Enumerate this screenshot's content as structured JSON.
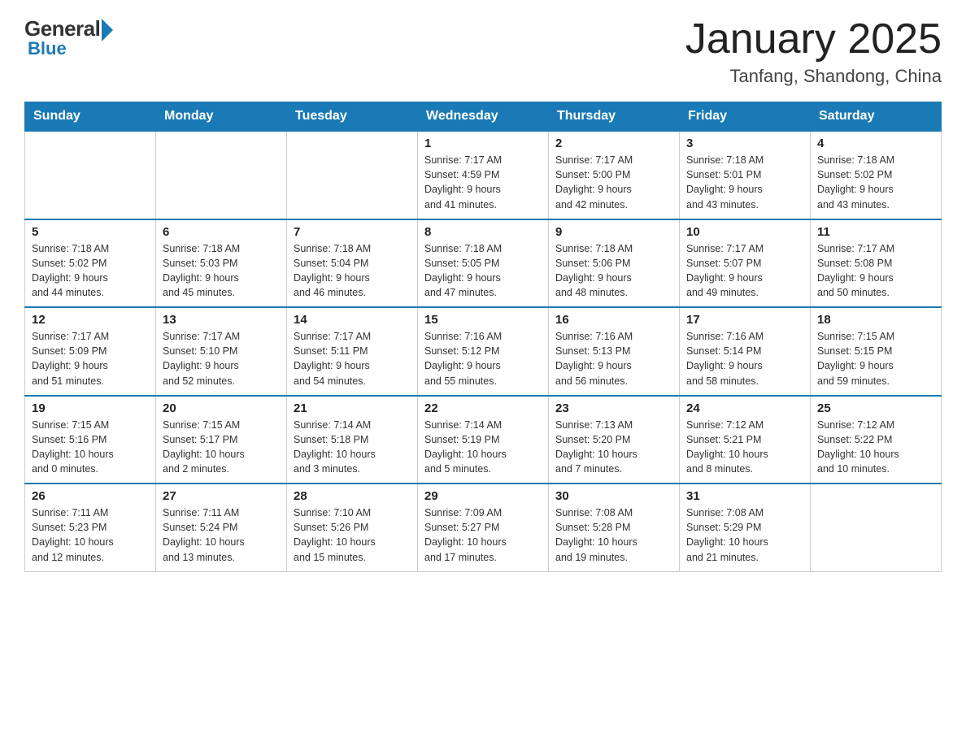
{
  "header": {
    "logo_general": "General",
    "logo_blue": "Blue",
    "title": "January 2025",
    "location": "Tanfang, Shandong, China"
  },
  "days_of_week": [
    "Sunday",
    "Monday",
    "Tuesday",
    "Wednesday",
    "Thursday",
    "Friday",
    "Saturday"
  ],
  "weeks": [
    [
      {
        "day": "",
        "info": ""
      },
      {
        "day": "",
        "info": ""
      },
      {
        "day": "",
        "info": ""
      },
      {
        "day": "1",
        "info": "Sunrise: 7:17 AM\nSunset: 4:59 PM\nDaylight: 9 hours\nand 41 minutes."
      },
      {
        "day": "2",
        "info": "Sunrise: 7:17 AM\nSunset: 5:00 PM\nDaylight: 9 hours\nand 42 minutes."
      },
      {
        "day": "3",
        "info": "Sunrise: 7:18 AM\nSunset: 5:01 PM\nDaylight: 9 hours\nand 43 minutes."
      },
      {
        "day": "4",
        "info": "Sunrise: 7:18 AM\nSunset: 5:02 PM\nDaylight: 9 hours\nand 43 minutes."
      }
    ],
    [
      {
        "day": "5",
        "info": "Sunrise: 7:18 AM\nSunset: 5:02 PM\nDaylight: 9 hours\nand 44 minutes."
      },
      {
        "day": "6",
        "info": "Sunrise: 7:18 AM\nSunset: 5:03 PM\nDaylight: 9 hours\nand 45 minutes."
      },
      {
        "day": "7",
        "info": "Sunrise: 7:18 AM\nSunset: 5:04 PM\nDaylight: 9 hours\nand 46 minutes."
      },
      {
        "day": "8",
        "info": "Sunrise: 7:18 AM\nSunset: 5:05 PM\nDaylight: 9 hours\nand 47 minutes."
      },
      {
        "day": "9",
        "info": "Sunrise: 7:18 AM\nSunset: 5:06 PM\nDaylight: 9 hours\nand 48 minutes."
      },
      {
        "day": "10",
        "info": "Sunrise: 7:17 AM\nSunset: 5:07 PM\nDaylight: 9 hours\nand 49 minutes."
      },
      {
        "day": "11",
        "info": "Sunrise: 7:17 AM\nSunset: 5:08 PM\nDaylight: 9 hours\nand 50 minutes."
      }
    ],
    [
      {
        "day": "12",
        "info": "Sunrise: 7:17 AM\nSunset: 5:09 PM\nDaylight: 9 hours\nand 51 minutes."
      },
      {
        "day": "13",
        "info": "Sunrise: 7:17 AM\nSunset: 5:10 PM\nDaylight: 9 hours\nand 52 minutes."
      },
      {
        "day": "14",
        "info": "Sunrise: 7:17 AM\nSunset: 5:11 PM\nDaylight: 9 hours\nand 54 minutes."
      },
      {
        "day": "15",
        "info": "Sunrise: 7:16 AM\nSunset: 5:12 PM\nDaylight: 9 hours\nand 55 minutes."
      },
      {
        "day": "16",
        "info": "Sunrise: 7:16 AM\nSunset: 5:13 PM\nDaylight: 9 hours\nand 56 minutes."
      },
      {
        "day": "17",
        "info": "Sunrise: 7:16 AM\nSunset: 5:14 PM\nDaylight: 9 hours\nand 58 minutes."
      },
      {
        "day": "18",
        "info": "Sunrise: 7:15 AM\nSunset: 5:15 PM\nDaylight: 9 hours\nand 59 minutes."
      }
    ],
    [
      {
        "day": "19",
        "info": "Sunrise: 7:15 AM\nSunset: 5:16 PM\nDaylight: 10 hours\nand 0 minutes."
      },
      {
        "day": "20",
        "info": "Sunrise: 7:15 AM\nSunset: 5:17 PM\nDaylight: 10 hours\nand 2 minutes."
      },
      {
        "day": "21",
        "info": "Sunrise: 7:14 AM\nSunset: 5:18 PM\nDaylight: 10 hours\nand 3 minutes."
      },
      {
        "day": "22",
        "info": "Sunrise: 7:14 AM\nSunset: 5:19 PM\nDaylight: 10 hours\nand 5 minutes."
      },
      {
        "day": "23",
        "info": "Sunrise: 7:13 AM\nSunset: 5:20 PM\nDaylight: 10 hours\nand 7 minutes."
      },
      {
        "day": "24",
        "info": "Sunrise: 7:12 AM\nSunset: 5:21 PM\nDaylight: 10 hours\nand 8 minutes."
      },
      {
        "day": "25",
        "info": "Sunrise: 7:12 AM\nSunset: 5:22 PM\nDaylight: 10 hours\nand 10 minutes."
      }
    ],
    [
      {
        "day": "26",
        "info": "Sunrise: 7:11 AM\nSunset: 5:23 PM\nDaylight: 10 hours\nand 12 minutes."
      },
      {
        "day": "27",
        "info": "Sunrise: 7:11 AM\nSunset: 5:24 PM\nDaylight: 10 hours\nand 13 minutes."
      },
      {
        "day": "28",
        "info": "Sunrise: 7:10 AM\nSunset: 5:26 PM\nDaylight: 10 hours\nand 15 minutes."
      },
      {
        "day": "29",
        "info": "Sunrise: 7:09 AM\nSunset: 5:27 PM\nDaylight: 10 hours\nand 17 minutes."
      },
      {
        "day": "30",
        "info": "Sunrise: 7:08 AM\nSunset: 5:28 PM\nDaylight: 10 hours\nand 19 minutes."
      },
      {
        "day": "31",
        "info": "Sunrise: 7:08 AM\nSunset: 5:29 PM\nDaylight: 10 hours\nand 21 minutes."
      },
      {
        "day": "",
        "info": ""
      }
    ]
  ]
}
